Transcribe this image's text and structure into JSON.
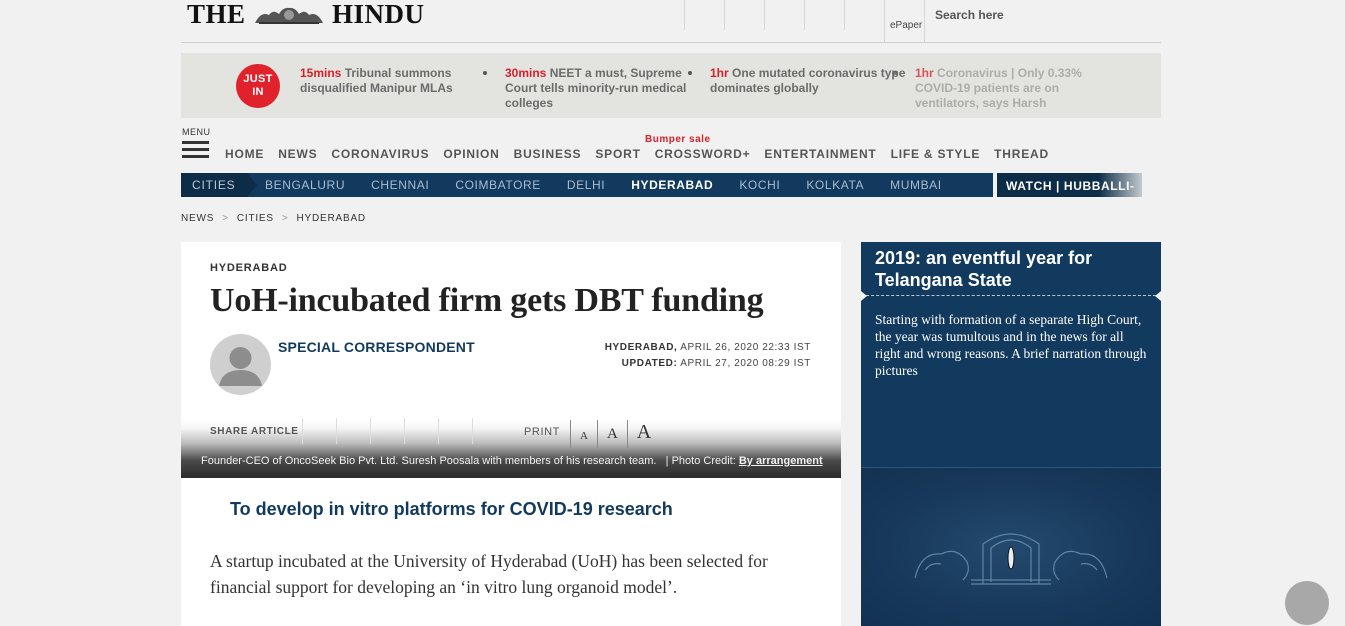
{
  "header": {
    "logo_text_left": "THE",
    "logo_text_right": "HINDU",
    "epaper_label": "ePaper",
    "search_placeholder": "Search here"
  },
  "just_in": {
    "badge": "JUST IN",
    "items": [
      {
        "time": "15mins",
        "text": "Tribunal summons disqualified Manipur MLAs"
      },
      {
        "time": "30mins",
        "text": "NEET a must, Supreme Court tells minority-run medical colleges"
      },
      {
        "time": "1hr",
        "text": "One mutated coronavirus type dominates globally"
      },
      {
        "time": "1hr",
        "text": "Coronavirus | Only 0.33% COVID-19 patients are on ventilators, says Harsh"
      }
    ]
  },
  "nav": {
    "menu_label": "MENU",
    "items": [
      "HOME",
      "NEWS",
      "CORONAVIRUS",
      "OPINION",
      "BUSINESS",
      "SPORT",
      "CROSSWORD+",
      "ENTERTAINMENT",
      "LIFE & STYLE",
      "THREAD"
    ],
    "bumper_label": "Bumper sale"
  },
  "cities": {
    "tag": "CITIES",
    "items": [
      "BENGALURU",
      "CHENNAI",
      "COIMBATORE",
      "DELHI",
      "HYDERABAD",
      "KOCHI",
      "KOLKATA",
      "MUMBAI"
    ],
    "active": "HYDERABAD",
    "watch_label": "WATCH | HUBBALLI-"
  },
  "breadcrumb": [
    "NEWS",
    "CITIES",
    "HYDERABAD"
  ],
  "article": {
    "section": "HYDERABAD",
    "headline": "UoH-incubated firm gets DBT funding",
    "author": "SPECIAL CORRESPONDENT",
    "dateline_place": "HYDERABAD,",
    "published": "APRIL 26, 2020 22:33 IST",
    "updated_label": "UPDATED:",
    "updated": "APRIL 27, 2020 08:29 IST",
    "share_label": "SHARE ARTICLE",
    "print_label": "PRINT",
    "font_sizes": [
      "A",
      "A",
      "A"
    ],
    "caption": "Founder-CEO of OncoSeek Bio Pvt. Ltd. Suresh Poosala with members of his research team.",
    "credit_label": "| Photo Credit:",
    "credit": "By arrangement",
    "subhead": "To develop in vitro platforms for COVID-19 research",
    "body": "A startup incubated at the University of Hyderabad (UoH) has been selected for financial support for developing an ‘in vitro lung organoid model’."
  },
  "side_panel": {
    "title": "2019: an eventful year for Telangana State",
    "description": "Starting with formation of a separate High Court, the year was tumultous and in the news for all right and wrong reasons. A brief narration through pictures"
  }
}
